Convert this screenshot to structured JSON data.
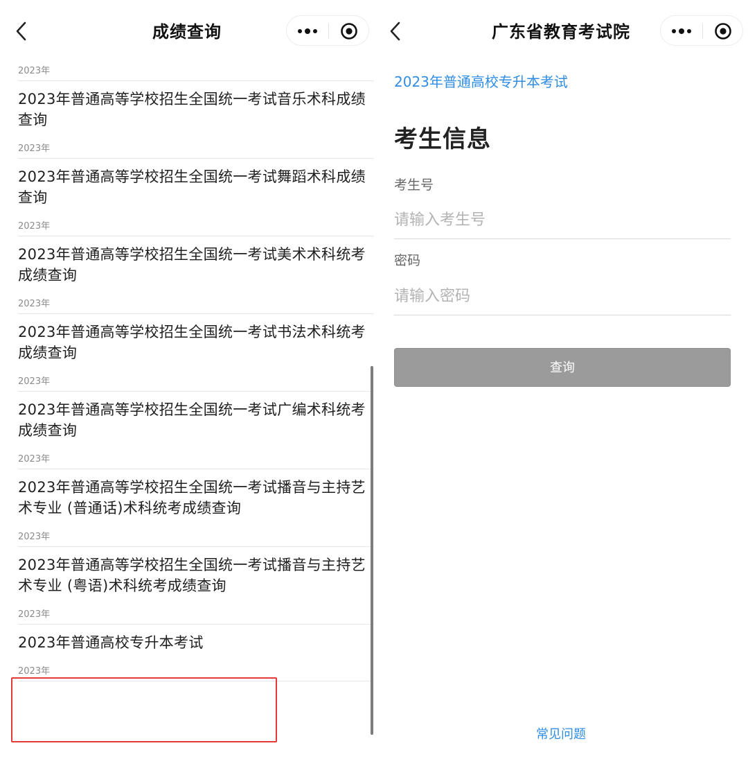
{
  "left": {
    "nav": {
      "title": "成绩查询"
    },
    "items": [
      {
        "year": "2023年",
        "title": "2023年普通高等学校招生全国统一考试音乐术科成绩查询"
      },
      {
        "year": "2023年",
        "title": "2023年普通高等学校招生全国统一考试舞蹈术科成绩查询"
      },
      {
        "year": "2023年",
        "title": "2023年普通高等学校招生全国统一考试美术术科统考成绩查询"
      },
      {
        "year": "2023年",
        "title": "2023年普通高等学校招生全国统一考试书法术科统考成绩查询"
      },
      {
        "year": "2023年",
        "title": "2023年普通高等学校招生全国统一考试广编术科统考成绩查询"
      },
      {
        "year": "2023年",
        "title": "2023年普通高等学校招生全国统一考试播音与主持艺术专业 (普通话)术科统考成绩查询"
      },
      {
        "year": "2023年",
        "title": "2023年普通高等学校招生全国统一考试播音与主持艺术专业 (粤语)术科统考成绩查询"
      },
      {
        "year": "2023年",
        "title": "2023年普通高校专升本考试"
      },
      {
        "year": "2023年",
        "title": ""
      }
    ]
  },
  "right": {
    "nav": {
      "title": "广东省教育考试院"
    },
    "exam_title": "2023年普通高校专升本考试",
    "section_title": "考生信息",
    "fields": {
      "candidate_no": {
        "label": "考生号",
        "placeholder": "请输入考生号",
        "value": ""
      },
      "password": {
        "label": "密码",
        "placeholder": "请输入密码",
        "value": ""
      }
    },
    "query_button": "查询",
    "faq_link": "常见问题"
  },
  "colors": {
    "link_blue": "#2f8de4",
    "highlight_red": "#e53935",
    "button_gray": "#9b9b9b"
  }
}
